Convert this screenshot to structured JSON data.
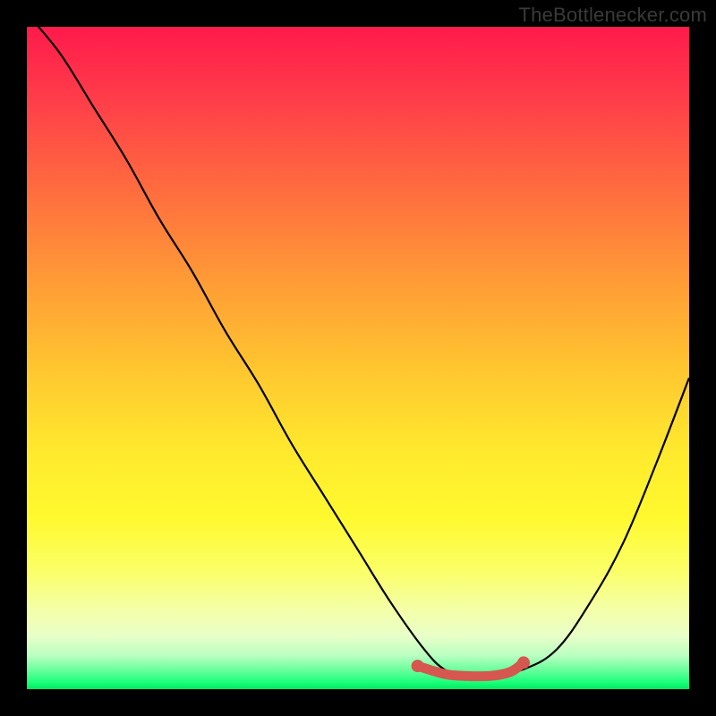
{
  "watermark": "TheBottlenecker.com",
  "colors": {
    "curve": "#000000",
    "trough": "#d6574f",
    "frame_bg_top": "#ff1a4b",
    "frame_bg_bottom": "#00e860",
    "page_bg": "#000000"
  },
  "chart_data": {
    "type": "line",
    "title": "",
    "xlabel": "",
    "ylabel": "",
    "xlim": [
      0,
      100
    ],
    "ylim": [
      0,
      100
    ],
    "series": [
      {
        "name": "bottleneck-curve",
        "x": [
          0,
          5,
          10,
          15,
          20,
          25,
          30,
          35,
          40,
          45,
          50,
          55,
          60,
          63,
          66,
          70,
          75,
          80,
          85,
          90,
          95,
          100
        ],
        "values": [
          102,
          96,
          88,
          80,
          71,
          63,
          54,
          46,
          37,
          29,
          21,
          13,
          6,
          3,
          2,
          2,
          3,
          6,
          13,
          22,
          34,
          47
        ]
      },
      {
        "name": "optimal-range",
        "x": [
          59,
          63,
          66,
          70,
          73,
          75
        ],
        "values": [
          3.5,
          2.3,
          2.0,
          2.0,
          2.6,
          4.0
        ]
      }
    ],
    "annotations": []
  }
}
